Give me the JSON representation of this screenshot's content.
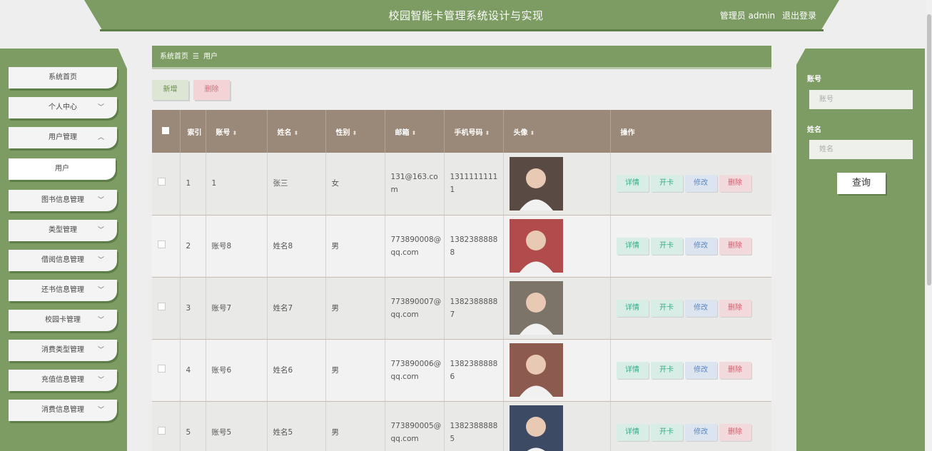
{
  "header": {
    "title": "校园智能卡管理系统设计与实现",
    "user_label": "管理员 admin",
    "logout": "退出登录"
  },
  "sidebar": {
    "items": [
      {
        "label": "系统首页",
        "chev": ""
      },
      {
        "label": "个人中心",
        "chev": "﹀"
      },
      {
        "label": "用户管理",
        "chev": "︿"
      },
      {
        "label": "用户",
        "chev": ""
      },
      {
        "label": "图书信息管理",
        "chev": "﹀"
      },
      {
        "label": "类型管理",
        "chev": "﹀"
      },
      {
        "label": "借阅信息管理",
        "chev": "﹀"
      },
      {
        "label": "还书信息管理",
        "chev": "﹀"
      },
      {
        "label": "校园卡管理",
        "chev": "﹀"
      },
      {
        "label": "消费类型管理",
        "chev": "﹀"
      },
      {
        "label": "充值信息管理",
        "chev": "﹀"
      },
      {
        "label": "消费信息管理",
        "chev": "﹀"
      }
    ]
  },
  "breadcrumb": {
    "home": "系统首页",
    "sep": "☰",
    "current": "用户"
  },
  "actions": {
    "add": "新增",
    "delete": "删除"
  },
  "table": {
    "headers": [
      "",
      "索引",
      "账号",
      "姓名",
      "性别",
      "邮箱",
      "手机号码",
      "头像",
      "操作"
    ],
    "row_actions": [
      "详情",
      "开卡",
      "修改",
      "删除"
    ],
    "rows": [
      {
        "index": "1",
        "account": "1",
        "name": "张三",
        "gender": "女",
        "email": "131@163.com",
        "phone": "13111111111",
        "avatar_color": "#5a4a44"
      },
      {
        "index": "2",
        "account": "账号8",
        "name": "姓名8",
        "gender": "男",
        "email": "773890008@qq.com",
        "phone": "13823888888",
        "avatar_color": "#b24b4b"
      },
      {
        "index": "3",
        "account": "账号7",
        "name": "姓名7",
        "gender": "男",
        "email": "773890007@qq.com",
        "phone": "13823888887",
        "avatar_color": "#7c7468"
      },
      {
        "index": "4",
        "account": "账号6",
        "name": "姓名6",
        "gender": "男",
        "email": "773890006@qq.com",
        "phone": "13823888886",
        "avatar_color": "#8c5a4e"
      },
      {
        "index": "5",
        "account": "账号5",
        "name": "姓名5",
        "gender": "男",
        "email": "773890005@qq.com",
        "phone": "13823888885",
        "avatar_color": "#3c4a63"
      }
    ]
  },
  "search": {
    "account_label": "账号",
    "account_placeholder": "账号",
    "name_label": "姓名",
    "name_placeholder": "姓名",
    "query": "查询"
  }
}
